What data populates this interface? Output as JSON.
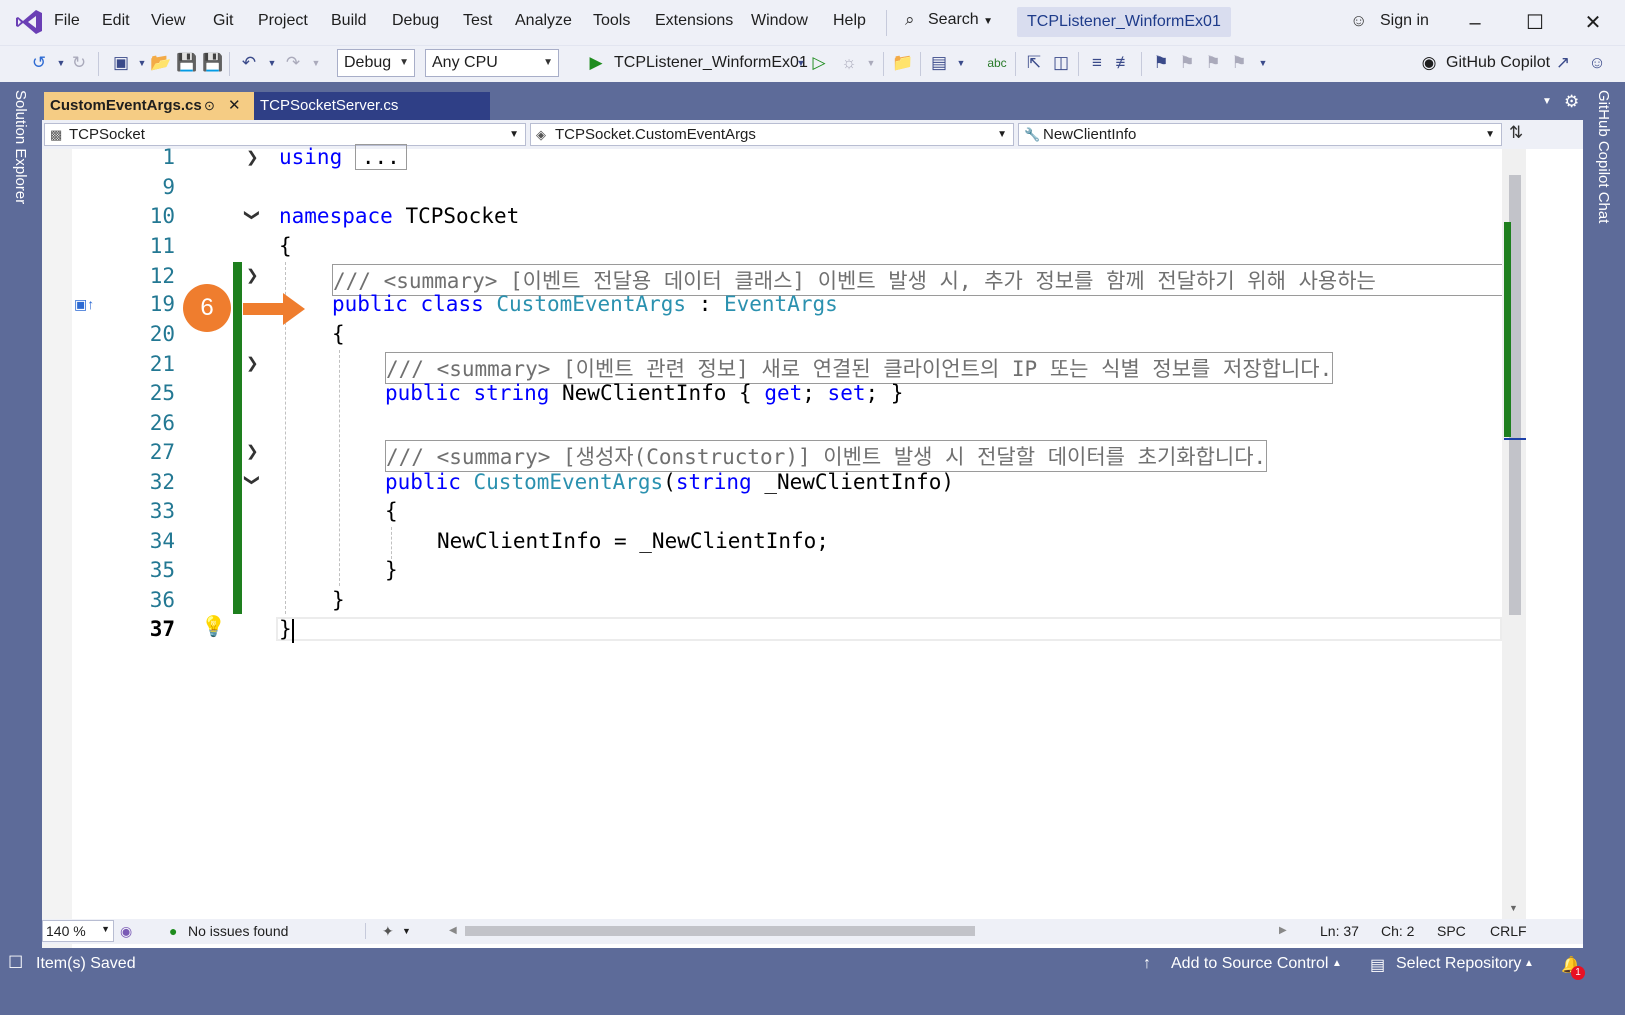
{
  "menu": [
    "File",
    "Edit",
    "View",
    "Git",
    "Project",
    "Build",
    "Debug",
    "Test",
    "Analyze",
    "Tools",
    "Extensions",
    "Window",
    "Help"
  ],
  "search_label": "Search",
  "solution_name": "TCPListener_WinformEx01",
  "signin": "Sign in",
  "toolbar": {
    "config": "Debug",
    "platform": "Any CPU",
    "run_target": "TCPListener_WinformEx01",
    "copilot": "GitHub Copilot"
  },
  "side": {
    "left": "Solution Explorer",
    "right": "GitHub Copilot Chat"
  },
  "tabs": [
    {
      "label": "CustomEventArgs.cs",
      "active": true
    },
    {
      "label": "TCPSocketServer.cs",
      "active": false
    }
  ],
  "nav": {
    "project": "TCPSocket",
    "type": "TCPSocket.CustomEventArgs",
    "member": "NewClientInfo"
  },
  "code": {
    "l1_kw": "using",
    "l1_collapsed": "...",
    "l10_kw": "namespace",
    "l10_name": "TCPSocket",
    "l11": "{",
    "l12": "/// <summary> [이벤트 전달용 데이터 클래스] 이벤트 발생 시, 추가 정보를 함께 전달하기 위해 사용하는",
    "l19_kw1": "public",
    "l19_kw2": "class",
    "l19_type": "CustomEventArgs",
    "l19_colon": " : ",
    "l19_base": "EventArgs",
    "l20": "{",
    "l21": "/// <summary> [이벤트 관련 정보] 새로 연결된 클라이언트의 IP 또는 식별 정보를 저장합니다.",
    "l25_kw1": "public",
    "l25_kw2": "string",
    "l25_name": " NewClientInfo { ",
    "l25_get": "get",
    "l25_mid": "; ",
    "l25_set": "set",
    "l25_end": "; }",
    "l27": "/// <summary> [생성자(Constructor)] 이벤트 발생 시 전달할 데이터를 초기화합니다.",
    "l32_kw": "public",
    "l32_type": "CustomEventArgs",
    "l32_open": "(",
    "l32_kw2": "string",
    "l32_rest": " _NewClientInfo)",
    "l33": "{",
    "l34": "NewClientInfo = _NewClientInfo;",
    "l35": "}",
    "l36": "}",
    "l37": "}"
  },
  "line_numbers": [
    "1",
    "9",
    "10",
    "11",
    "12",
    "19",
    "20",
    "21",
    "25",
    "26",
    "27",
    "32",
    "33",
    "34",
    "35",
    "36",
    "37"
  ],
  "annotation_number": "6",
  "editor_status": {
    "zoom": "140 %",
    "issues": "No issues found",
    "ln": "Ln: 37",
    "ch": "Ch: 2",
    "spc": "SPC",
    "crlf": "CRLF"
  },
  "statusbar": {
    "left": "Item(s) Saved",
    "source": "Add to Source Control",
    "repo": "Select Repository",
    "notif_count": "1"
  },
  "colors": {
    "accent_orange": "#ef7d2e",
    "green_change": "#1e7f1e",
    "chrome": "#5d6b99"
  }
}
